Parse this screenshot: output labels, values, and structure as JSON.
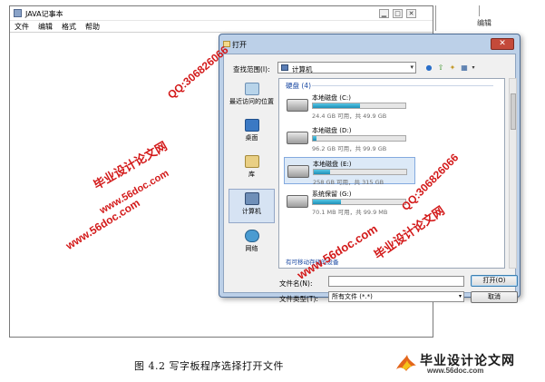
{
  "notepad": {
    "title": "JAVA记事本",
    "menu": [
      "文件",
      "编辑",
      "格式",
      "帮助"
    ],
    "window_buttons": [
      "▁",
      "□",
      "✕"
    ]
  },
  "background_window": {
    "title": "编辑"
  },
  "dialog": {
    "title": "打开",
    "close_label": "✕",
    "look_in_label": "查找范围(I):",
    "look_in_value": "计算机",
    "toolbar_icons": [
      "back-icon",
      "up-folder-icon",
      "new-folder-icon",
      "view-menu-icon"
    ],
    "places": [
      {
        "label": "最近访问的位置",
        "icon": "recent-places-icon"
      },
      {
        "label": "桌面",
        "icon": "desktop-icon"
      },
      {
        "label": "库",
        "icon": "libraries-icon"
      },
      {
        "label": "计算机",
        "icon": "computer-icon",
        "selected": true
      },
      {
        "label": "网络",
        "icon": "network-icon"
      }
    ],
    "group_header": "硬盘 (4)",
    "drives": [
      {
        "name": "本地磁盘 (C:)",
        "info": "24.4 GB 可用，共 49.9 GB",
        "used_fraction": 0.51,
        "icon": "windows-drive-icon"
      },
      {
        "name": "本地磁盘 (D:)",
        "info": "96.2 GB 可用，共 99.9 GB",
        "used_fraction": 0.04,
        "icon": "hard-drive-icon"
      },
      {
        "name": "本地磁盘 (E:)",
        "info": "258 GB 可用，共 315 GB",
        "used_fraction": 0.18,
        "icon": "hard-drive-icon",
        "selected": true
      },
      {
        "name": "系统保留 (G:)",
        "info": "70.1 MB 可用，共 99.9 MB",
        "used_fraction": 0.3,
        "icon": "hard-drive-icon"
      }
    ],
    "removable_header": "有可移动存储的设备",
    "filename_label": "文件名(N):",
    "filename_value": "",
    "filetype_label": "文件类型(T):",
    "filetype_value": "所有文件 (*.*)",
    "open_button": "打开(O)",
    "cancel_button": "取消"
  },
  "watermarks": {
    "brand": "毕业设计论文网",
    "url": "www.56doc.com",
    "qq": "QQ:306826066"
  },
  "caption": "图 4.2   写字板程序选择打开文件",
  "logo": {
    "title": "毕业设计论文网",
    "url": "www.56doc.com"
  }
}
